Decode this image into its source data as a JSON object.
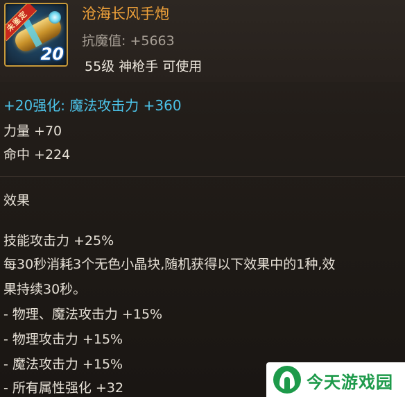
{
  "item": {
    "icon_name": "hand-cannon-icon",
    "ribbon_text": "未鉴定",
    "enhance_badge": "20",
    "name": "沧海长风手炮",
    "resist": "抗魔值: +5663",
    "requirement": "55级 神枪手 可使用",
    "name_color": "#f0a23a"
  },
  "stats": {
    "enhance_line": "+20强化: 魔法攻击力 +360",
    "enhance_color": "#4cc4ea",
    "strength": "力量 +70",
    "hit": "命中 +224"
  },
  "effect": {
    "title": "效果",
    "skill": "技能攻击力 +25%",
    "desc_line1": "每30秒消耗3个无色小晶块,随机获得以下效果中的1种,效",
    "desc_line2": "果持续30秒。",
    "options": [
      "- 物理、魔法攻击力 +15%",
      "- 物理攻击力 +15%",
      "- 魔法攻击力 +15%",
      "- 所有属性强化 +32"
    ]
  },
  "watermark": {
    "text": "今天游戏园",
    "logo_icon": "leaf-logo-icon",
    "color": "#1d9a4a"
  }
}
